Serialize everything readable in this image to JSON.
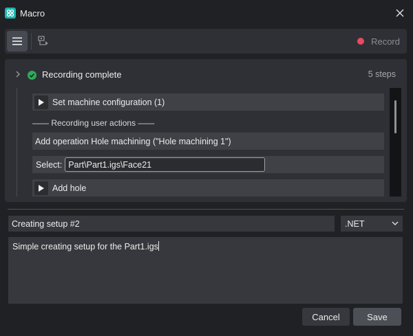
{
  "window": {
    "title": "Macro",
    "app_icon": "macro-app-icon",
    "close_icon": "close-icon"
  },
  "toolbar": {
    "menu_icon": "hamburger-menu-icon",
    "playback_icon": "run-macro-icon",
    "record_label": "Record",
    "record_color": "#e84a5f"
  },
  "recording": {
    "status": "Recording complete",
    "step_count": "5 steps",
    "status_color": "#2cab5a",
    "steps": [
      {
        "type": "expandable",
        "label": "Set machine configuration (1)"
      },
      {
        "type": "heading",
        "label": "—— Recording user actions ——"
      },
      {
        "type": "action",
        "label": "Add operation Hole machining (\"Hole machining 1\")"
      },
      {
        "type": "select",
        "label": "Select:",
        "value": "Part\\Part1.igs\\Face21"
      },
      {
        "type": "expandable",
        "label": "Add hole"
      }
    ]
  },
  "form": {
    "name_value": "Creating setup #2",
    "language": ".NET",
    "description": "Simple creating setup for the Part1.igs"
  },
  "buttons": {
    "cancel": "Cancel",
    "save": "Save"
  }
}
